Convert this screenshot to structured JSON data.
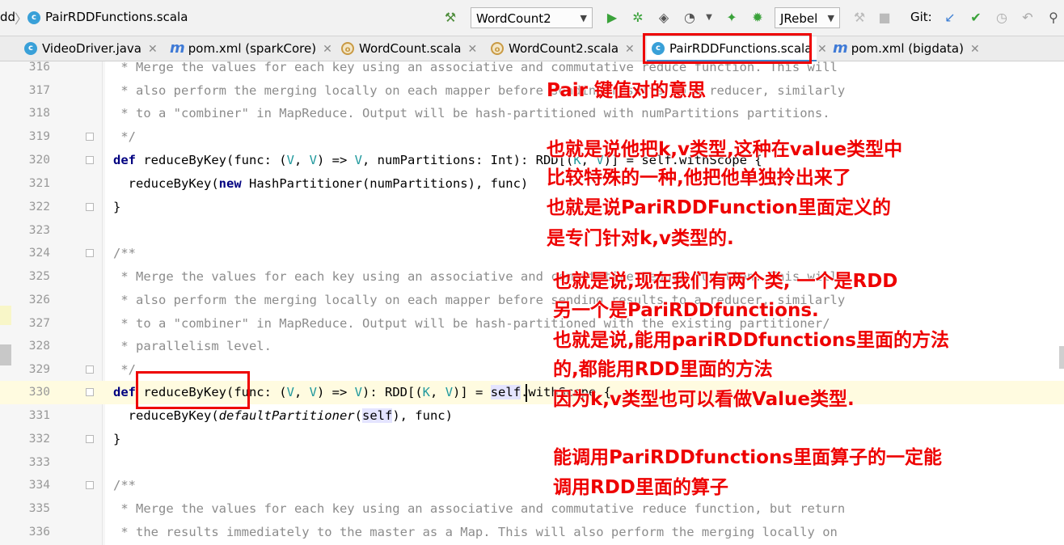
{
  "topbar": {
    "crumb_prev": "dd",
    "crumb_file": "PairRDDFunctions.scala",
    "run_config": "WordCount2",
    "jrebel": "JRebel",
    "git_label": "Git:"
  },
  "tabs": [
    {
      "label": "VideoDriver.java",
      "icon": "c"
    },
    {
      "label": "pom.xml (sparkCore)",
      "icon": "m"
    },
    {
      "label": "WordCount.scala",
      "icon": "o"
    },
    {
      "label": "WordCount2.scala",
      "icon": "o"
    },
    {
      "label": "PairRDDFunctions.scala",
      "icon": "c",
      "active": true
    },
    {
      "label": "pom.xml (bigdata)",
      "icon": "m"
    }
  ],
  "editor": {
    "lines": [
      {
        "n": "316"
      },
      {
        "n": "317"
      },
      {
        "n": "318"
      },
      {
        "n": "319"
      },
      {
        "n": "320"
      },
      {
        "n": "321"
      },
      {
        "n": "322"
      },
      {
        "n": "323"
      },
      {
        "n": "324"
      },
      {
        "n": "325"
      },
      {
        "n": "326"
      },
      {
        "n": "327"
      },
      {
        "n": "328"
      },
      {
        "n": "329"
      },
      {
        "n": "330"
      },
      {
        "n": "331"
      },
      {
        "n": "332"
      },
      {
        "n": "333"
      },
      {
        "n": "334"
      },
      {
        "n": "335"
      },
      {
        "n": "336"
      }
    ],
    "code": {
      "l316": " * Merge the values for each key using an associative and commutative reduce function. This will",
      "l317": " * also perform the merging locally on each mapper before sending results to a reducer, similarly",
      "l318": " * to a \"combiner\" in MapReduce. Output will be hash-partitioned with numPartitions partitions.",
      "l319": " */",
      "l320_kw": "def",
      "l320_a": " reduceByKey(func: (",
      "l320_t1": "V",
      "l320_b": ", ",
      "l320_t2": "V",
      "l320_c": ") => ",
      "l320_t3": "V",
      "l320_d": ", numPartitions: Int): RDD[(",
      "l320_t4": "K",
      "l320_e": ", ",
      "l320_t5": "V",
      "l320_f": ")] = self.withScope {",
      "l321_a": "  reduceByKey(",
      "l321_kw": "new",
      "l321_b": " HashPartitioner(numPartitions), func)",
      "l322": "}",
      "l324": "/**",
      "l325": " * Merge the values for each key using an associative and commutative reduce function. This will",
      "l326": " * also perform the merging locally on each mapper before sending results to a reducer, similarly",
      "l327": " * to a \"combiner\" in MapReduce. Output will be hash-partitioned with the existing partitioner/",
      "l328": " * parallelism level.",
      "l329": " */",
      "l330_kw": "def",
      "l330_a": " reduceByKey(func: (",
      "l330_t1": "V",
      "l330_b": ", ",
      "l330_t2": "V",
      "l330_c": ") => ",
      "l330_t3": "V",
      "l330_d": "): RDD[(",
      "l330_t4": "K",
      "l330_e": ", ",
      "l330_t5": "V",
      "l330_f": ")] = ",
      "l330_self": "self",
      "l330_g": ".withScope {",
      "l331_a": "  reduceByKey(",
      "l331_it": "defaultPartitioner",
      "l331_b": "(",
      "l331_self": "self",
      "l331_c": "), func)",
      "l332": "}",
      "l334": "/**",
      "l335": " * Merge the values for each key using an associative and commutative reduce function, but return",
      "l336": " * the results immediately to the master as a Map. This will also perform the merging locally on"
    }
  },
  "annotations": {
    "a1": "Pair 键值对的意思",
    "a2": "也就是说他把k,v类型,这种在value类型中",
    "a3": "比较特殊的一种,他把他单独拎出来了",
    "a4": "也就是说PariRDDFunction里面定义的",
    "a5": "是专门针对k,v类型的.",
    "a6": "也就是说,现在我们有两个类, 一个是RDD",
    "a7": "另一个是PariRDDfunctions.",
    "a8": "也就是说,能用pariRDDfunctions里面的方法",
    "a9": "的,都能用RDD里面的方法",
    "a10": "因为k,v类型也可以看做Value类型.",
    "a11": "能调用PariRDDfunctions里面算子的一定能",
    "a12": "调用RDD里面的算子"
  },
  "colors": {
    "annotation": "#ee0000",
    "keyword": "#000080",
    "type_param": "#20999d",
    "comment": "#8c8c8c"
  }
}
